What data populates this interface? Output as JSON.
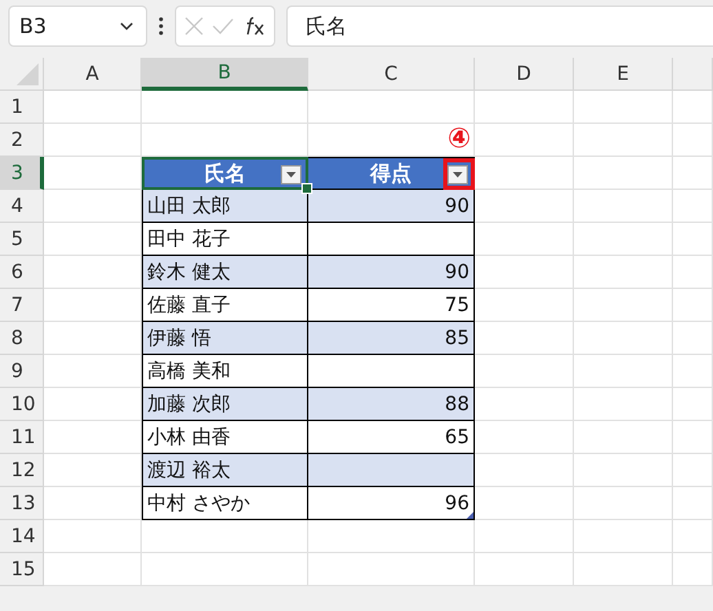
{
  "name_box": {
    "value": "B3"
  },
  "formula_bar": {
    "value": "氏名"
  },
  "columns": [
    {
      "label": "A",
      "selected": false
    },
    {
      "label": "B",
      "selected": true
    },
    {
      "label": "C",
      "selected": false
    },
    {
      "label": "D",
      "selected": false
    },
    {
      "label": "E",
      "selected": false
    }
  ],
  "rows": [
    {
      "label": "1",
      "selected": false
    },
    {
      "label": "2",
      "selected": false
    },
    {
      "label": "3",
      "selected": true
    },
    {
      "label": "4",
      "selected": false
    },
    {
      "label": "5",
      "selected": false
    },
    {
      "label": "6",
      "selected": false
    },
    {
      "label": "7",
      "selected": false
    },
    {
      "label": "8",
      "selected": false
    },
    {
      "label": "9",
      "selected": false
    },
    {
      "label": "10",
      "selected": false
    },
    {
      "label": "11",
      "selected": false
    },
    {
      "label": "12",
      "selected": false
    },
    {
      "label": "13",
      "selected": false
    },
    {
      "label": "14",
      "selected": false
    },
    {
      "label": "15",
      "selected": false
    }
  ],
  "table": {
    "header": [
      {
        "label": "氏名",
        "selected": true,
        "highlighted": false
      },
      {
        "label": "得点",
        "selected": false,
        "highlighted": true
      }
    ],
    "annotation": "④",
    "rows": [
      {
        "name": "山田 太郎",
        "score": "90",
        "banded": true
      },
      {
        "name": "田中 花子",
        "banded": false
      },
      {
        "name": "鈴木 健太",
        "score": "90",
        "banded": true
      },
      {
        "name": "佐藤 直子",
        "score": "75",
        "banded": false
      },
      {
        "name": "伊藤 悟",
        "score": "85",
        "banded": true
      },
      {
        "name": "高橋 美和",
        "banded": false
      },
      {
        "name": "加藤 次郎",
        "score": "88",
        "banded": true
      },
      {
        "name": "小林 由香",
        "score": "65",
        "banded": false
      },
      {
        "name": "渡辺 裕太",
        "banded": true
      },
      {
        "name": "中村 さやか",
        "score": "96",
        "banded": false
      }
    ]
  }
}
